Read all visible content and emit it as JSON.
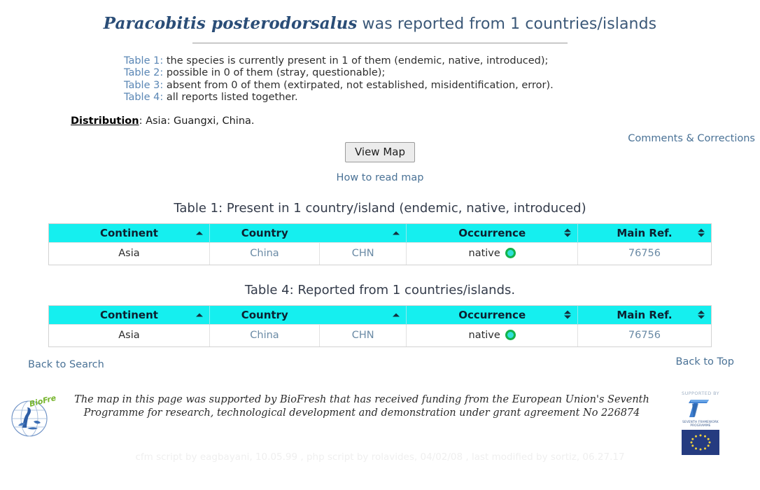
{
  "title": {
    "species": "Paracobitis posterodorsalus",
    "rest": " was reported from 1 countries/islands"
  },
  "table_list": [
    {
      "label": "Table 1:",
      "text": " the species is currently present in 1 of them (endemic, native, introduced);"
    },
    {
      "label": "Table 2:",
      "text": " possible in 0 of them (stray, questionable);"
    },
    {
      "label": "Table 3:",
      "text": " absent from 0 of them (extirpated, not established, misidentification, error)."
    },
    {
      "label": "Table 4:",
      "text": " all reports listed together."
    }
  ],
  "distribution": {
    "label": "Distribution",
    "value": ": Asia: Guangxi, China."
  },
  "links": {
    "comments": "Comments & Corrections",
    "how_to_read_map": "How to read map",
    "back_to_search": "Back to Search",
    "back_to_top": "Back to Top"
  },
  "buttons": {
    "view_map": "View Map"
  },
  "tables": [
    {
      "caption": "Table 1: Present in 1 country/island (endemic, native, introduced)",
      "headers": [
        {
          "label": "Continent",
          "sort": "asc"
        },
        {
          "label": "Country",
          "sort": "asc"
        },
        {
          "label": "",
          "sort": "none"
        },
        {
          "label": "Occurrence",
          "sort": "both"
        },
        {
          "label": "Main Ref.",
          "sort": "both"
        }
      ],
      "rows": [
        {
          "continent": "Asia",
          "country": "China",
          "code": "CHN",
          "occurrence": "native",
          "occurrence_icon": "green-ring-icon",
          "main_ref": "76756"
        }
      ]
    },
    {
      "caption": "Table 4: Reported from 1 countries/islands.",
      "headers": [
        {
          "label": "Continent",
          "sort": "asc"
        },
        {
          "label": "Country",
          "sort": "asc"
        },
        {
          "label": "",
          "sort": "none"
        },
        {
          "label": "Occurrence",
          "sort": "both"
        },
        {
          "label": "Main Ref.",
          "sort": "both"
        }
      ],
      "rows": [
        {
          "continent": "Asia",
          "country": "China",
          "code": "CHN",
          "occurrence": "native",
          "occurrence_icon": "green-ring-icon",
          "main_ref": "76756"
        }
      ]
    }
  ],
  "footer": {
    "funding_text": "The map in this page was supported by BioFresh that has received funding from the European Union's Seventh Programme for research, technological development and demonstration under grant agreement No 226874",
    "supported_by": "SUPPORTED BY",
    "fp7_caption": "SEVENTH FRAMEWORK PROGRAMME",
    "logo_name": "biofresh-logo",
    "eu_flag_name": "eu-flag",
    "credits": "cfm script by eagbayani, 10.05.99 ,  php script by rolavides, 04/02/08 ,  last modified by sortiz, 06.27.17"
  },
  "colors": {
    "header_cyan": "#15efef",
    "link_blue": "#4a7296",
    "title_blue": "#2a4d77",
    "occurrence_green": "#12b34a"
  }
}
